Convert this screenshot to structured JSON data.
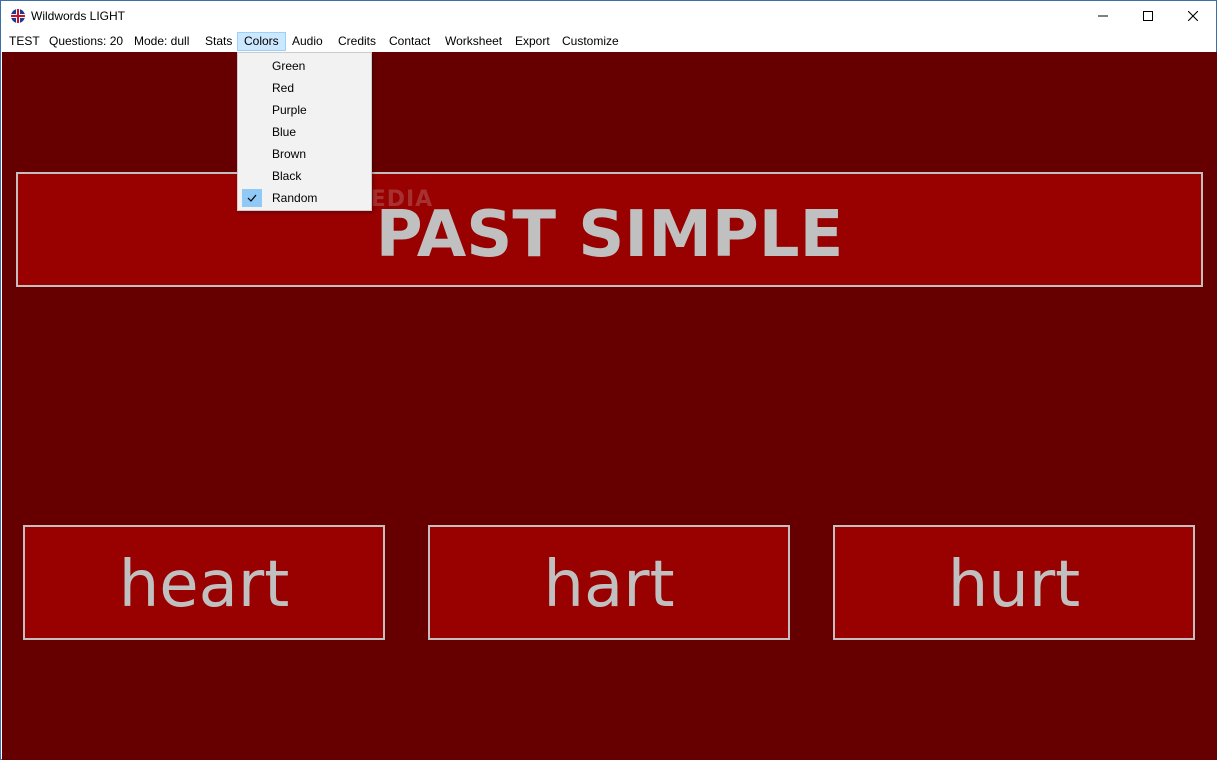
{
  "window": {
    "title": "Wildwords LIGHT"
  },
  "menubar": {
    "items": [
      {
        "label": "TEST"
      },
      {
        "label": "Questions: 20"
      },
      {
        "label": "Mode: dull"
      },
      {
        "label": "Stats"
      },
      {
        "label": "Colors",
        "active": true
      },
      {
        "label": "Audio"
      },
      {
        "label": "Credits"
      },
      {
        "label": "Contact"
      },
      {
        "label": "Worksheet"
      },
      {
        "label": "Export"
      },
      {
        "label": "Customize"
      }
    ]
  },
  "colors_menu": {
    "items": [
      {
        "label": "Green",
        "checked": false
      },
      {
        "label": "Red",
        "checked": false
      },
      {
        "label": "Purple",
        "checked": false
      },
      {
        "label": "Blue",
        "checked": false
      },
      {
        "label": "Brown",
        "checked": false
      },
      {
        "label": "Black",
        "checked": false
      },
      {
        "label": "Random",
        "checked": true
      }
    ]
  },
  "question": {
    "prompt": "PAST SIMPLE"
  },
  "answers": [
    {
      "label": "heart"
    },
    {
      "label": "hart"
    },
    {
      "label": "hurt"
    }
  ],
  "watermark": "SOFTPEDIA",
  "theme": {
    "background": "#660000",
    "panel": "#990000",
    "text": "#c0c0c0",
    "border": "#c4bebe"
  },
  "icons": {
    "app": "uk-flag-icon",
    "minimize": "minimize-icon",
    "maximize": "maximize-icon",
    "close": "close-icon",
    "check": "check-icon"
  }
}
